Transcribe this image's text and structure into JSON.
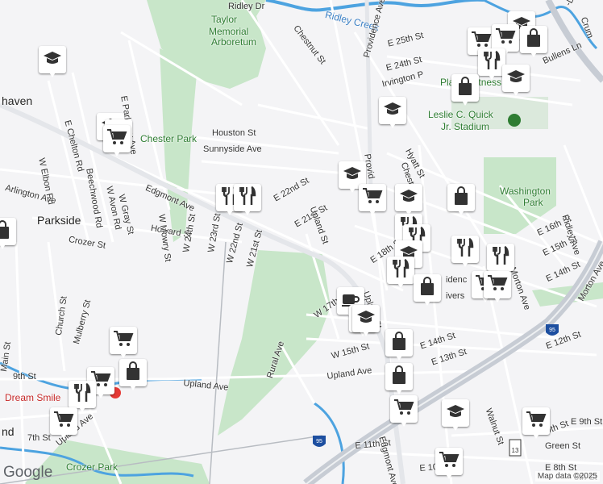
{
  "map": {
    "attribution": "Map data ©2025",
    "logo": "Google",
    "colors": {
      "park": "#c8e6c9",
      "water": "#4da3e0",
      "road": "#ffffff",
      "highway": "#c7ccd4",
      "land": "#f4f4f6"
    }
  },
  "labels": [
    {
      "text": "Ridley Dr",
      "cls": ""
    },
    {
      "text": "Ridley Creek",
      "cls": "water"
    },
    {
      "text": "Taylor",
      "cls": "park"
    },
    {
      "text": "Memorial",
      "cls": "park"
    },
    {
      "text": "Arboretum",
      "cls": "park"
    },
    {
      "text": "Chestnut St",
      "cls": ""
    },
    {
      "text": "Providence Ave",
      "cls": ""
    },
    {
      "text": "E 25th St",
      "cls": ""
    },
    {
      "text": "E 24th St",
      "cls": ""
    },
    {
      "text": "Bullens Ln",
      "cls": ""
    },
    {
      "text": "Irvington P",
      "cls": ""
    },
    {
      "text": "Planet Fitness",
      "cls": "poi"
    },
    {
      "text": "Leslie C. Quick",
      "cls": "poi"
    },
    {
      "text": "Jr. Stadium",
      "cls": "poi"
    },
    {
      "text": "Chester Park",
      "cls": "park"
    },
    {
      "text": "Houston St",
      "cls": ""
    },
    {
      "text": "Sunnyside Ave",
      "cls": ""
    },
    {
      "text": "Hyatt St",
      "cls": ""
    },
    {
      "text": "Washington",
      "cls": "park"
    },
    {
      "text": "Park",
      "cls": "park"
    },
    {
      "text": "haven",
      "cls": "big"
    },
    {
      "text": "E Chelton Rd",
      "cls": ""
    },
    {
      "text": "E Parkway Ave",
      "cls": ""
    },
    {
      "text": "W Elbon Rd",
      "cls": ""
    },
    {
      "text": "Beechwood Rd",
      "cls": ""
    },
    {
      "text": "W Avon Rd",
      "cls": ""
    },
    {
      "text": "W Gray St",
      "cls": ""
    },
    {
      "text": "Arlington Ave",
      "cls": ""
    },
    {
      "text": "Parkside",
      "cls": "big"
    },
    {
      "text": "Edgmont Ave",
      "cls": ""
    },
    {
      "text": "E 22nd St",
      "cls": ""
    },
    {
      "text": "E 21st St",
      "cls": ""
    },
    {
      "text": "Upland St",
      "cls": ""
    },
    {
      "text": "Howard St",
      "cls": ""
    },
    {
      "text": "Crozer St",
      "cls": ""
    },
    {
      "text": "W Mowry St",
      "cls": ""
    },
    {
      "text": "W 24th St",
      "cls": ""
    },
    {
      "text": "W 23rd St",
      "cls": ""
    },
    {
      "text": "W 22nd St",
      "cls": ""
    },
    {
      "text": "W 21st St",
      "cls": ""
    },
    {
      "text": "E 16th St",
      "cls": ""
    },
    {
      "text": "Ridley Ave",
      "cls": ""
    },
    {
      "text": "E 15th St",
      "cls": ""
    },
    {
      "text": "E 14th St",
      "cls": ""
    },
    {
      "text": "Morton Ave",
      "cls": ""
    },
    {
      "text": "E 18th St",
      "cls": ""
    },
    {
      "text": "W 17th",
      "cls": ""
    },
    {
      "text": "W 15th St",
      "cls": ""
    },
    {
      "text": "E 14th St",
      "cls": ""
    },
    {
      "text": "E 13th St",
      "cls": ""
    },
    {
      "text": "E 12th St",
      "cls": ""
    },
    {
      "text": "Rural Ave",
      "cls": ""
    },
    {
      "text": "Upland Ave",
      "cls": ""
    },
    {
      "text": "Upland Ave",
      "cls": ""
    },
    {
      "text": "Church St",
      "cls": ""
    },
    {
      "text": "Mulberry St",
      "cls": ""
    },
    {
      "text": "Main St",
      "cls": ""
    },
    {
      "text": "9th St",
      "cls": ""
    },
    {
      "text": "Dream Smile",
      "cls": "red"
    },
    {
      "text": "7th St",
      "cls": ""
    },
    {
      "text": "Upland Ave",
      "cls": ""
    },
    {
      "text": "Crozer Park",
      "cls": "park"
    },
    {
      "text": "E 11th St",
      "cls": ""
    },
    {
      "text": "Edgmont Ave",
      "cls": ""
    },
    {
      "text": "E 10th",
      "cls": ""
    },
    {
      "text": "Walnut St",
      "cls": ""
    },
    {
      "text": "9th St",
      "cls": ""
    },
    {
      "text": "Green St",
      "cls": ""
    },
    {
      "text": "E 8th St",
      "cls": ""
    },
    {
      "text": "Morton Ave",
      "cls": ""
    },
    {
      "text": "Upland St",
      "cls": ""
    },
    {
      "text": "Chestnut",
      "cls": ""
    },
    {
      "text": "idenc",
      "cls": ""
    },
    {
      "text": "ivers",
      "cls": ""
    },
    {
      "text": "Provid",
      "cls": ""
    },
    {
      "text": "-Dade Blvd",
      "cls": ""
    },
    {
      "text": "Crum",
      "cls": ""
    },
    {
      "text": "nd",
      "cls": "big"
    },
    {
      "text": "8th St",
      "cls": ""
    },
    {
      "text": "E 9th St",
      "cls": ""
    }
  ],
  "pins": [
    {
      "icon": "school"
    },
    {
      "icon": "school"
    },
    {
      "icon": "shopping-cart"
    },
    {
      "icon": "shopping-cart"
    },
    {
      "icon": "shopping-bag"
    },
    {
      "icon": "restaurant"
    },
    {
      "icon": "school"
    },
    {
      "icon": "school"
    },
    {
      "icon": "school"
    },
    {
      "icon": "school"
    },
    {
      "icon": "shopping-cart"
    },
    {
      "icon": "shopping-cart"
    },
    {
      "icon": "school"
    },
    {
      "icon": "restaurant"
    },
    {
      "icon": "restaurant"
    },
    {
      "icon": "restaurant"
    },
    {
      "icon": "restaurant"
    },
    {
      "icon": "restaurant"
    },
    {
      "icon": "shopping-bag"
    },
    {
      "icon": "school"
    },
    {
      "icon": "restaurant"
    },
    {
      "icon": "restaurant"
    },
    {
      "icon": "shopping-bag"
    },
    {
      "icon": "shopping-cart"
    },
    {
      "icon": "shopping-cart"
    },
    {
      "icon": "coffee"
    },
    {
      "icon": "shopping-cart"
    },
    {
      "icon": "school"
    },
    {
      "icon": "shopping-bag"
    },
    {
      "icon": "shopping-bag"
    },
    {
      "icon": "shopping-cart"
    },
    {
      "icon": "school"
    },
    {
      "icon": "shopping-cart"
    },
    {
      "icon": "shopping-cart"
    },
    {
      "icon": "shopping-bag"
    },
    {
      "icon": "shopping-cart"
    },
    {
      "icon": "restaurant"
    },
    {
      "icon": "shopping-cart"
    },
    {
      "icon": "shopping-cart"
    },
    {
      "icon": "school"
    },
    {
      "icon": "shopping-bag"
    },
    {
      "icon": "shopping-bag"
    }
  ]
}
